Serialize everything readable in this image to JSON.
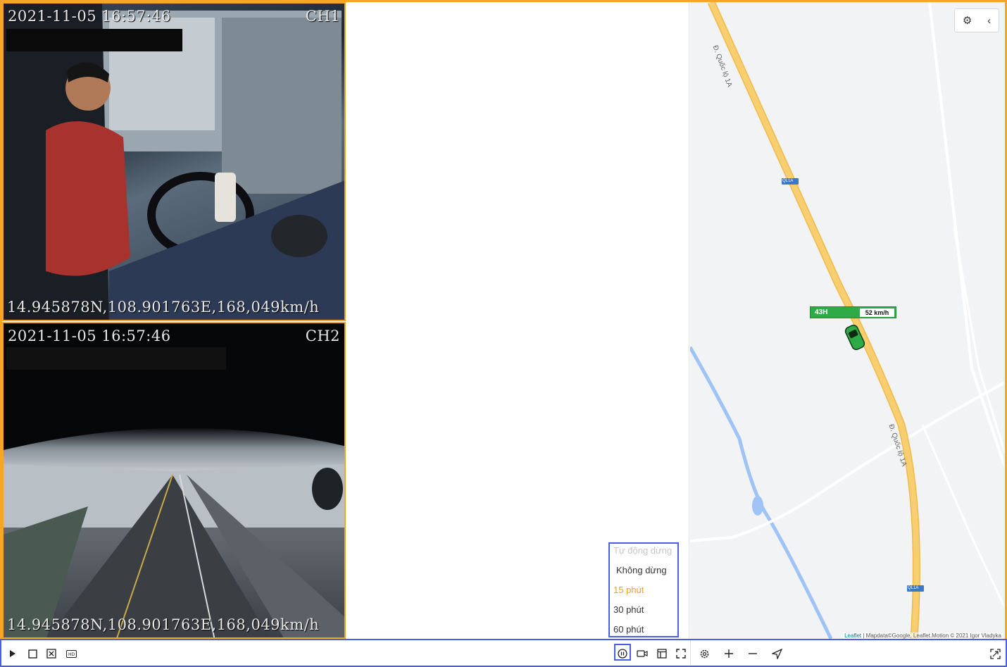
{
  "cameras": [
    {
      "timestamp": "2021-11-05 16:57:46",
      "channel": "CH1",
      "gps_overlay": "14.945878N,108.901763E,168,049km/h"
    },
    {
      "timestamp": "2021-11-05 16:57:46",
      "channel": "CH2",
      "gps_overlay": "14.945878N,108.901763E,168,049km/h"
    }
  ],
  "map": {
    "road_labels": [
      "Đ. Quốc lộ 1A",
      "Đ. Quốc lộ 1A"
    ],
    "shields": [
      "QL1A",
      "QL1A"
    ],
    "vehicle": {
      "plate": "43H",
      "speed": "52 km/h"
    },
    "attribution": {
      "leaflet": "Leaflet",
      "rest": " | Mapdata©Google, Leaflet.Motion © 2021 Igor Vladyka"
    },
    "controls": {
      "settings_icon": "gear-icon",
      "collapse_icon": "chevron-left-icon"
    },
    "colors": {
      "road": "#f7ce70",
      "water": "#9fc3f5",
      "vehicle": "#2eaa46"
    }
  },
  "auto_stop_menu": {
    "header": "Tự động dừng",
    "options": [
      "Không dừng",
      "15 phút",
      "30 phút",
      "60 phút"
    ],
    "selected": "15 phút"
  },
  "toolbar": {
    "left_icons": [
      "play-icon",
      "stop-icon",
      "close-all-icon",
      "hd-icon"
    ],
    "hd_label": "HD",
    "right_icons": [
      "auto-stop-icon",
      "record-icon",
      "layout-icon",
      "fullscreen-icon"
    ],
    "map_icons": [
      "gear-icon",
      "zoom-in-icon",
      "zoom-out-icon",
      "locate-icon",
      "expand-icon"
    ]
  }
}
